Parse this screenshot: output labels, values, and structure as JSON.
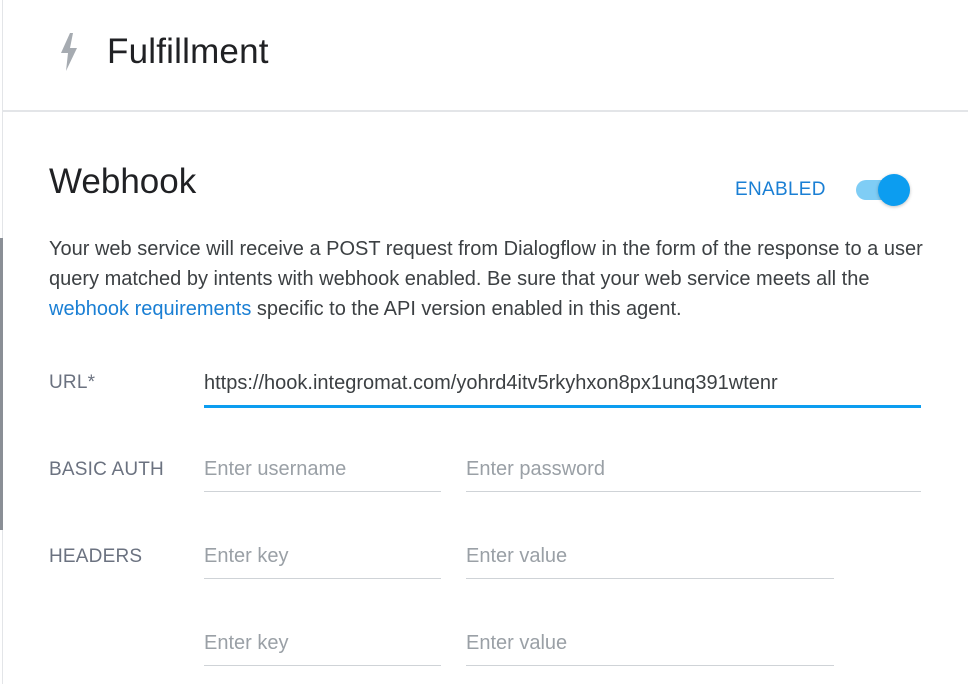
{
  "header": {
    "icon": "lightning-bolt-icon",
    "title": "Fulfillment"
  },
  "webhook": {
    "title": "Webhook",
    "status_label": "ENABLED",
    "toggle_on": true,
    "description_before": "Your web service will receive a POST request from Dialogflow in the form of the response to a user query matched by intents with webhook enabled. Be sure that your web service meets all the ",
    "description_link": "webhook requirements",
    "description_after": " specific to the API version enabled in this agent."
  },
  "form": {
    "url_label": "URL*",
    "url_value": "https://hook.integromat.com/yohrd4itv5rkyhxon8px1unq391wtenr",
    "basic_auth_label": "BASIC AUTH",
    "username_placeholder": "Enter username",
    "password_placeholder": "Enter password",
    "headers_label": "HEADERS",
    "headers": [
      {
        "key_placeholder": "Enter key",
        "value_placeholder": "Enter value"
      },
      {
        "key_placeholder": "Enter key",
        "value_placeholder": "Enter value"
      }
    ]
  },
  "colors": {
    "accent": "#0c9df0",
    "link": "#1a7fd4",
    "toggle_track": "#7fcdf5"
  }
}
